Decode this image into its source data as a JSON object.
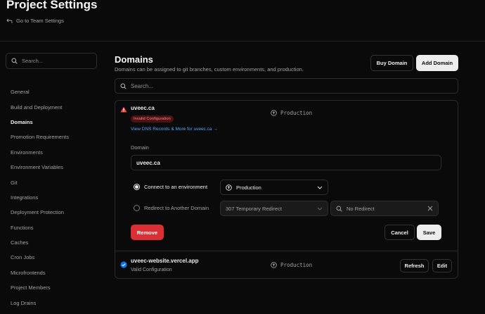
{
  "header": {
    "title": "Project Settings",
    "back_link": "Go to Team Settings"
  },
  "sidebar": {
    "search_placeholder": "Search...",
    "items": [
      {
        "label": "General"
      },
      {
        "label": "Build and Deployment"
      },
      {
        "label": "Domains",
        "active": true
      },
      {
        "label": "Promotion Requirements"
      },
      {
        "label": "Environments"
      },
      {
        "label": "Environment Variables"
      },
      {
        "label": "Git"
      },
      {
        "label": "Integrations"
      },
      {
        "label": "Deployment Protection"
      },
      {
        "label": "Functions"
      },
      {
        "label": "Caches"
      },
      {
        "label": "Cron Jobs"
      },
      {
        "label": "Microfrontends"
      },
      {
        "label": "Project Members"
      },
      {
        "label": "Log Drains"
      }
    ]
  },
  "main": {
    "title": "Domains",
    "subtitle": "Domains can be assigned to git branches, custom environments, and production.",
    "buy_label": "Buy Domain",
    "add_label": "Add Domain",
    "search_placeholder": "Search..."
  },
  "domains": [
    {
      "name": "uveec.ca",
      "badge": "Invalid Configuration",
      "dns_link": "View DNS Records & More for uveec.ca →",
      "environment": "Production",
      "field_label": "Domain",
      "field_value": "uveec.ca",
      "option_connect": "Connect to an environment",
      "option_redirect": "Redirect to Another Domain",
      "env_select": "Production",
      "redirect_select": "307 Temporary Redirect",
      "redirect_target_placeholder": "No Redirect",
      "remove_label": "Remove",
      "cancel_label": "Cancel",
      "save_label": "Save"
    },
    {
      "name": "uveec-website.vercel.app",
      "status": "Valid Configuration",
      "environment": "Production",
      "refresh_label": "Refresh",
      "edit_label": "Edit"
    }
  ],
  "colors": {
    "background": "#0a0a0a",
    "danger": "#da2f35",
    "link": "#52a8ff",
    "valid": "#0a72ef"
  }
}
